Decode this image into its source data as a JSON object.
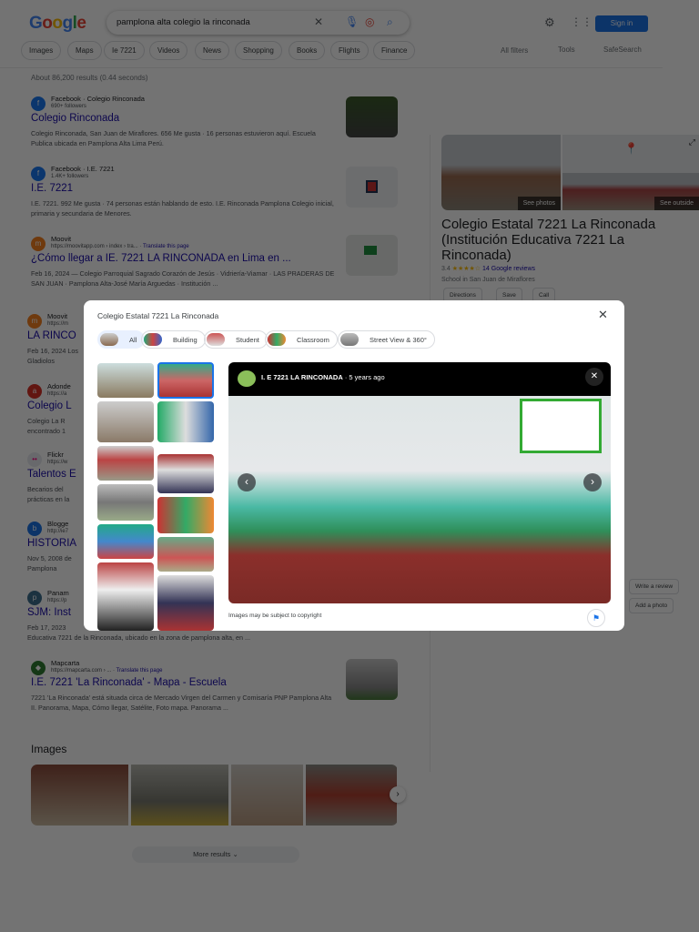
{
  "header": {
    "logo": "Google",
    "query": "pamplona alta colegio la rinconada",
    "sign_in": "Sign in"
  },
  "chips": [
    "Images",
    "Maps",
    "Ie 7221",
    "Videos",
    "News",
    "Shopping",
    "Books",
    "Flights",
    "Finance"
  ],
  "tools": {
    "all_filters": "All filters",
    "tools": "Tools",
    "safesearch": "SafeSearch"
  },
  "stats": "About 86,200 results (0.44 seconds)",
  "results": [
    {
      "source": "Facebook · Colegio Rinconada",
      "url": "690+ followers",
      "title": "Colegio Rinconada",
      "snippet": "Colegio Rinconada, San Juan de Miraflores. 656 Me gusta · 16 personas estuvieron aquí. Escuela Publica ubicada en Pamplona Alta Lima Perú."
    },
    {
      "source": "Facebook · I.E. 7221",
      "url": "1.4K+ followers",
      "title": "I.E. 7221",
      "snippet": "I.E. 7221. 992 Me gusta · 74 personas están hablando de esto. I.E. Rinconada Pamplona Colegio inicial, primaria y secundaria de Menores."
    },
    {
      "source": "Moovit",
      "url": "https://moovitapp.com › index › tra... ·",
      "translate": "Translate this page",
      "title": "¿Cómo llegar a IE. 7221 LA RINCONADA en Lima en ...",
      "snippet": "Feb 16, 2024 — Colegio Parroquial Sagrado Corazón de Jesús · Vidriería-Viamar · LAS PRADERAS DE SAN JUAN · Pamplona Alta-José María Arguedas · Institución ..."
    },
    {
      "source": "Moovit",
      "url": "https://m",
      "title": "LA RINCO",
      "snippet": "Feb 16, 2024 Los Gladiolos"
    },
    {
      "source": "Adonde",
      "url": "https://a",
      "title": "Colegio L",
      "snippet": "Colegio La R encontrado 1"
    },
    {
      "source": "Flickr",
      "url": "https://w",
      "title": "Talentos E",
      "snippet": "Becarios del prácticas en la"
    },
    {
      "source": "Blogge",
      "url": "http://ie7",
      "title": "HISTORIA",
      "snippet": "Nov 5, 2008 de Pamplona"
    },
    {
      "source": "Panam",
      "url": "https://p",
      "title": "SJM: Inst",
      "snippet": "Feb 17, 2023 Educativa 7221 de la Rinconada, ubicado en la zona de pamplona alta, en ..."
    },
    {
      "source": "Mapcarta",
      "url": "https://mapcarta.com › ... ·",
      "translate": "Translate this page",
      "title": "I.E. 7221 'La Rinconada' - Mapa - Escuela",
      "snippet": "7221 'La Rinconada' está situada circa de Mercado Virgen del Carmen y Comisaría PNP Pamplona Alta II. Panorama, Mapa, Cómo llegar, Satélite, Foto mapa. Panorama ..."
    }
  ],
  "images_section": {
    "title": "Images",
    "more": "More results"
  },
  "knowledge_panel": {
    "see_photos": "See photos",
    "see_outside": "See outside",
    "title": "Colegio Estatal 7221 La Rinconada (Institución Educativa 7221 La Rinconada)",
    "rating": "3.4",
    "rating_value": 3.4,
    "reviews": "14 Google reviews",
    "category": "School in San Juan de Miraflores",
    "buttons": [
      "Directions",
      "Save",
      "Call"
    ],
    "write_review": "Write a review",
    "add_photo": "Add a photo"
  },
  "modal": {
    "title": "Colegio Estatal 7221 La Rinconada",
    "filters": [
      "All",
      "Building",
      "Student",
      "Classroom",
      "Street View & 360°"
    ],
    "active_filter": "All",
    "viewer": {
      "author": "I. E 7221 LA RINCONADA",
      "time": "5 years ago"
    },
    "copyright": "Images may be subject to copyright"
  }
}
